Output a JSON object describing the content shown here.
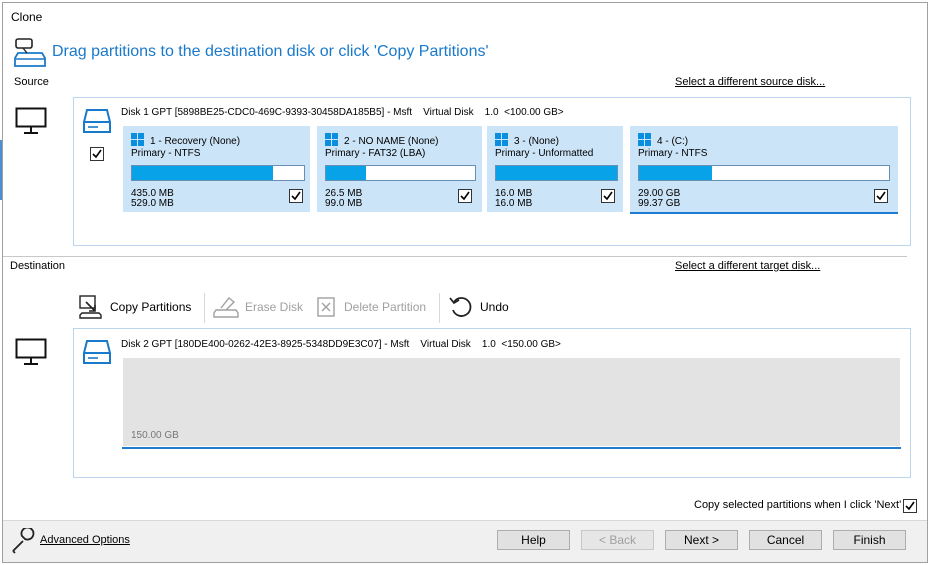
{
  "window": {
    "title": "Clone"
  },
  "header": {
    "instruction": "Drag partitions to the destination disk or click 'Copy Partitions'"
  },
  "source": {
    "label": "Source",
    "change_link": "Select a different source disk...",
    "disk_line": "Disk 1 GPT [5898BE25-CDC0-469C-9393-30458DA185B5] - Msft    Virtual Disk    1.0  <100.00 GB>",
    "disk_checked": true,
    "partitions": [
      {
        "name": "1 - Recovery (None)",
        "type": "Primary - NTFS",
        "used": "435.0 MB",
        "total": "529.0 MB",
        "used_fraction": 0.82,
        "checked": true
      },
      {
        "name": "2 - NO NAME (None)",
        "type": "Primary - FAT32 (LBA)",
        "used": "26.5 MB",
        "total": "99.0 MB",
        "used_fraction": 0.27,
        "checked": true
      },
      {
        "name": "3 -  (None)",
        "type": "Primary - Unformatted",
        "used": "16.0 MB",
        "total": "16.0 MB",
        "used_fraction": 1.0,
        "checked": true
      },
      {
        "name": "4 -  (C:)",
        "type": "Primary - NTFS",
        "used": "29.00 GB",
        "total": "99.37 GB",
        "used_fraction": 0.29,
        "checked": true
      }
    ]
  },
  "destination": {
    "label": "Destination",
    "change_link": "Select a different target disk...",
    "toolbar": {
      "copy_partitions": "Copy Partitions",
      "erase_disk": "Erase Disk",
      "delete_partition": "Delete Partition",
      "undo": "Undo"
    },
    "disk_line": "Disk 2 GPT [180DE400-0262-42E3-8925-5348DD9E3C07] - Msft    Virtual Disk    1.0  <150.00 GB>",
    "free_space": "150.00 GB"
  },
  "copy_on_next": {
    "label": "Copy selected partitions when I click 'Next'",
    "checked": true
  },
  "footer": {
    "advanced_options": "Advanced Options",
    "help": "Help",
    "back": "< Back",
    "next": "Next >",
    "cancel": "Cancel",
    "finish": "Finish"
  },
  "colors": {
    "accent": "#1979ca",
    "bar_fill": "#08a2e8",
    "tile_bg": "#cce4f7",
    "dest_area": "#e3e3e3"
  },
  "icons": [
    "clone-disk-icon",
    "monitor-icon",
    "disk-icon",
    "windows-logo-icon",
    "copy-partitions-icon",
    "erase-disk-icon",
    "delete-partition-icon",
    "undo-icon",
    "wrench-icon",
    "checkbox-check-icon"
  ]
}
